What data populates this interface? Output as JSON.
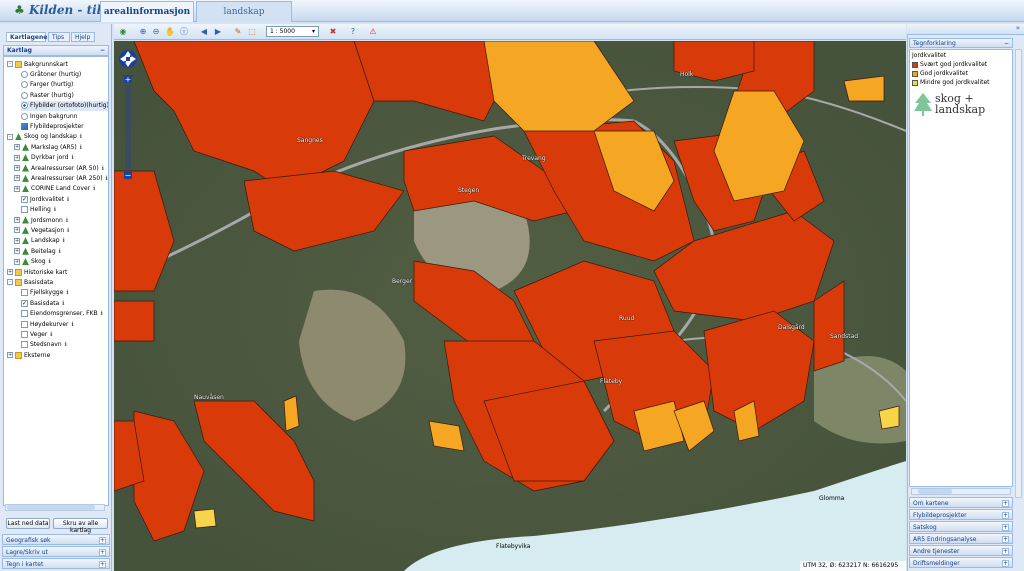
{
  "header": {
    "logo": "Kilden - til",
    "tabs": [
      "arealinformasjon",
      "landskap"
    ]
  },
  "left": {
    "tabs": [
      "Kartlagene",
      "Tips",
      "Hjelp"
    ],
    "panel_title": "Kartlag",
    "tree": [
      {
        "label": "Bakgrunnskart",
        "level": 0,
        "icon": "folder-icon",
        "expander": "-"
      },
      {
        "label": "Gråtoner (hurtig)",
        "level": 2,
        "icon": "radio-icon"
      },
      {
        "label": "Farger (hurtig)",
        "level": 2,
        "icon": "radio-icon"
      },
      {
        "label": "Raster (hurtig)",
        "level": 2,
        "icon": "radio-icon"
      },
      {
        "label": "Flybilder (ortofoto)(hurtig)",
        "level": 2,
        "icon": "radio-selected-icon"
      },
      {
        "label": "Ingen bakgrunn",
        "level": 2,
        "icon": "radio-icon"
      },
      {
        "label": "Flybildeprosjekter",
        "level": 2,
        "icon": "layer-icon"
      },
      {
        "label": "Skog og landskap",
        "level": 0,
        "icon": "tree-icon",
        "expander": "-",
        "info": true
      },
      {
        "label": "Markslag (AR5)",
        "level": 1,
        "icon": "tree-icon",
        "expander": "+",
        "info": true
      },
      {
        "label": "Dyrkbar jord",
        "level": 1,
        "icon": "tree-icon",
        "expander": "+",
        "info": true
      },
      {
        "label": "Arealressurser (AR 50)",
        "level": 1,
        "icon": "tree-icon",
        "expander": "+",
        "info": true
      },
      {
        "label": "Arealressurser (AR 250)",
        "level": 1,
        "icon": "tree-icon",
        "expander": "+",
        "info": true
      },
      {
        "label": "CORINE Land Cover",
        "level": 1,
        "icon": "tree-icon",
        "expander": "+",
        "info": true
      },
      {
        "label": "Jordkvalitet",
        "level": 2,
        "icon": "checkbox-checked-icon",
        "info": true
      },
      {
        "label": "Helling",
        "level": 2,
        "icon": "checkbox-icon",
        "info": true
      },
      {
        "label": "Jordsmonn",
        "level": 1,
        "icon": "tree-icon",
        "expander": "+",
        "info": true
      },
      {
        "label": "Vegetasjon",
        "level": 1,
        "icon": "tree-icon",
        "expander": "+",
        "info": true
      },
      {
        "label": "Landskap",
        "level": 1,
        "icon": "tree-icon",
        "expander": "+",
        "info": true
      },
      {
        "label": "Beitelag",
        "level": 1,
        "icon": "tree-icon",
        "expander": "+",
        "info": true
      },
      {
        "label": "Skog",
        "level": 1,
        "icon": "tree-icon",
        "expander": "+",
        "info": true
      },
      {
        "label": "Historiske kart",
        "level": 0,
        "icon": "folder-icon",
        "expander": "+"
      },
      {
        "label": "Basisdata",
        "level": 0,
        "icon": "folder-icon",
        "expander": "-"
      },
      {
        "label": "Fjellskygge",
        "level": 2,
        "icon": "checkbox-icon",
        "info": true
      },
      {
        "label": "Basisdata",
        "level": 2,
        "icon": "checkbox-checked-icon",
        "info": true
      },
      {
        "label": "Eiendomsgrenser, FKB",
        "level": 2,
        "icon": "checkbox-icon",
        "info": true
      },
      {
        "label": "Høydekurver",
        "level": 2,
        "icon": "checkbox-icon",
        "info": true
      },
      {
        "label": "Veger",
        "level": 2,
        "icon": "checkbox-icon",
        "info": true
      },
      {
        "label": "Stedsnavn",
        "level": 2,
        "icon": "checkbox-icon",
        "info": true
      },
      {
        "label": "Eksterne",
        "level": 0,
        "icon": "folder-icon",
        "expander": "+"
      }
    ],
    "buttons": {
      "last": "Last ned data",
      "skru": "Skru av alle kartlag"
    },
    "accordions": [
      "Geografisk søk",
      "Lagre/Skriv ut",
      "Tegn i kartet"
    ]
  },
  "toolbar": {
    "scale": "1 : 5000",
    "icons": [
      "overview-icon",
      "zoom-in-icon",
      "zoom-out-icon",
      "pan-hand-icon",
      "info-icon",
      "back-arrow-icon",
      "forward-arrow-icon",
      "measure-icon",
      "select-icon",
      "eraser-icon",
      "help-icon",
      "warning-icon"
    ]
  },
  "map": {
    "labels": [
      "Sangnes",
      "Trevang",
      "Stegen",
      "Holk",
      "Berger",
      "Ruud",
      "Flateby",
      "Nauvåsen",
      "Dalsgård",
      "Glomma",
      "Flatebyvika",
      "Sandstad"
    ],
    "coords": "UTM 32, Ø: 623217 N: 6616295"
  },
  "right": {
    "panel_title": "Tegnforklaring",
    "legend_title": "Jordkvalitet",
    "legend": [
      {
        "label": "Svært god jordkvalitet",
        "color": "#d83a0a"
      },
      {
        "label": "God jordkvalitet",
        "color": "#f5a623"
      },
      {
        "label": "Mindre god jordkvalitet",
        "color": "#f7d54a"
      }
    ],
    "logo_line1": "skog +",
    "logo_line2": "landskap",
    "accordions": [
      "Om kartene",
      "Flybildeprosjekter",
      "Satskog",
      "AR5 Endringsanalyse",
      "Andre tjenester",
      "Driftsmeldinger"
    ]
  }
}
